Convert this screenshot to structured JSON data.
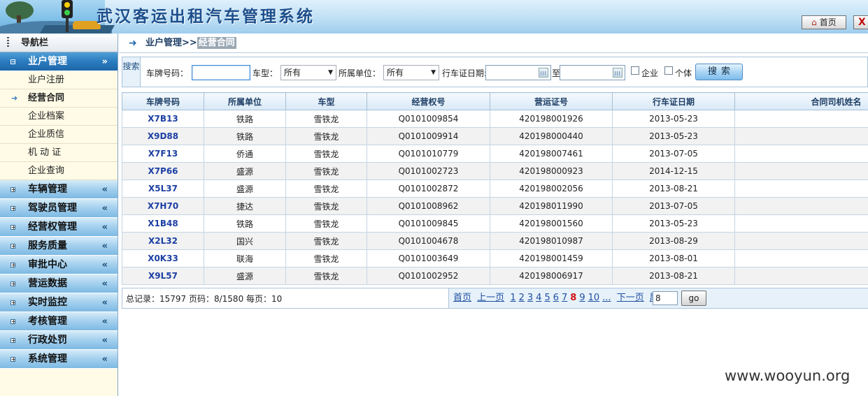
{
  "header": {
    "title": "武汉客运出租汽车管理系统",
    "home_label": "首页",
    "close_label": "X"
  },
  "sidebar": {
    "title": "导航栏",
    "active_group": {
      "label": "业户管理",
      "arrow": "«",
      "items": [
        {
          "label": "业户注册",
          "active": false
        },
        {
          "label": "经营合同",
          "active": true
        },
        {
          "label": "企业档案",
          "active": false
        },
        {
          "label": "企业质信",
          "active": false
        },
        {
          "label": "机 动 证",
          "active": false
        },
        {
          "label": "企业查询",
          "active": false
        }
      ]
    },
    "groups": [
      {
        "label": "车辆管理"
      },
      {
        "label": "驾驶员管理"
      },
      {
        "label": "经营权管理"
      },
      {
        "label": "服务质量"
      },
      {
        "label": "审批中心"
      },
      {
        "label": "营运数据"
      },
      {
        "label": "实时监控"
      },
      {
        "label": "考核管理"
      },
      {
        "label": "行政处罚"
      },
      {
        "label": "系统管理"
      }
    ]
  },
  "breadcrumb": {
    "parent": "业户管理>>",
    "current": "经营合同"
  },
  "search": {
    "tag": "搜索",
    "plate_label": "车牌号码：",
    "plate_value": "",
    "type_label": "车型：",
    "type_value": "所有",
    "unit_label": "所属单位：",
    "unit_value": "所有",
    "date_label": "行车证日期:",
    "date_to": "至",
    "date_from_value": "",
    "date_to_value": "",
    "company_label": "企业",
    "individual_label": "个体",
    "button_label": "搜索"
  },
  "table": {
    "columns": [
      "车牌号码",
      "所属单位",
      "车型",
      "经营权号",
      "营运证号",
      "行车证日期",
      "合同司机姓名"
    ],
    "rows": [
      [
        "X7B13",
        "铁路",
        "雪铁龙",
        "Q0101009854",
        "420198001926",
        "2013-05-23",
        ""
      ],
      [
        "X9D88",
        "铁路",
        "雪铁龙",
        "Q0101009914",
        "420198000440",
        "2013-05-23",
        ""
      ],
      [
        "X7F13",
        "侨通",
        "雪铁龙",
        "Q0101010779",
        "420198007461",
        "2013-07-05",
        ""
      ],
      [
        "X7P66",
        "盛源",
        "雪铁龙",
        "Q0101002723",
        "420198000923",
        "2014-12-15",
        ""
      ],
      [
        "X5L37",
        "盛源",
        "雪铁龙",
        "Q0101002872",
        "420198002056",
        "2013-08-21",
        ""
      ],
      [
        "X7H70",
        "捷达",
        "雪铁龙",
        "Q0101008962",
        "420198011990",
        "2013-07-05",
        ""
      ],
      [
        "X1B48",
        "铁路",
        "雪铁龙",
        "Q0101009845",
        "420198001560",
        "2013-05-23",
        ""
      ],
      [
        "X2L32",
        "国兴",
        "雪铁龙",
        "Q0101004678",
        "420198010987",
        "2013-08-29",
        ""
      ],
      [
        "X0K33",
        "联海",
        "雪铁龙",
        "Q0101003649",
        "420198001459",
        "2013-08-01",
        ""
      ],
      [
        "X9L57",
        "盛源",
        "雪铁龙",
        "Q0101002952",
        "420198006917",
        "2013-08-21",
        ""
      ]
    ]
  },
  "pager": {
    "info": "总记录：15797 页码：8/1580 每页：10",
    "first": "首页",
    "prev": "上一页",
    "pages": [
      "1",
      "2",
      "3",
      "4",
      "5",
      "6",
      "7",
      "8",
      "9",
      "10",
      "..."
    ],
    "current_page": "8",
    "next": "下一页",
    "last": "尾页",
    "goto_value": "8",
    "go_label": "go"
  },
  "watermark": "www.wooyun.org"
}
